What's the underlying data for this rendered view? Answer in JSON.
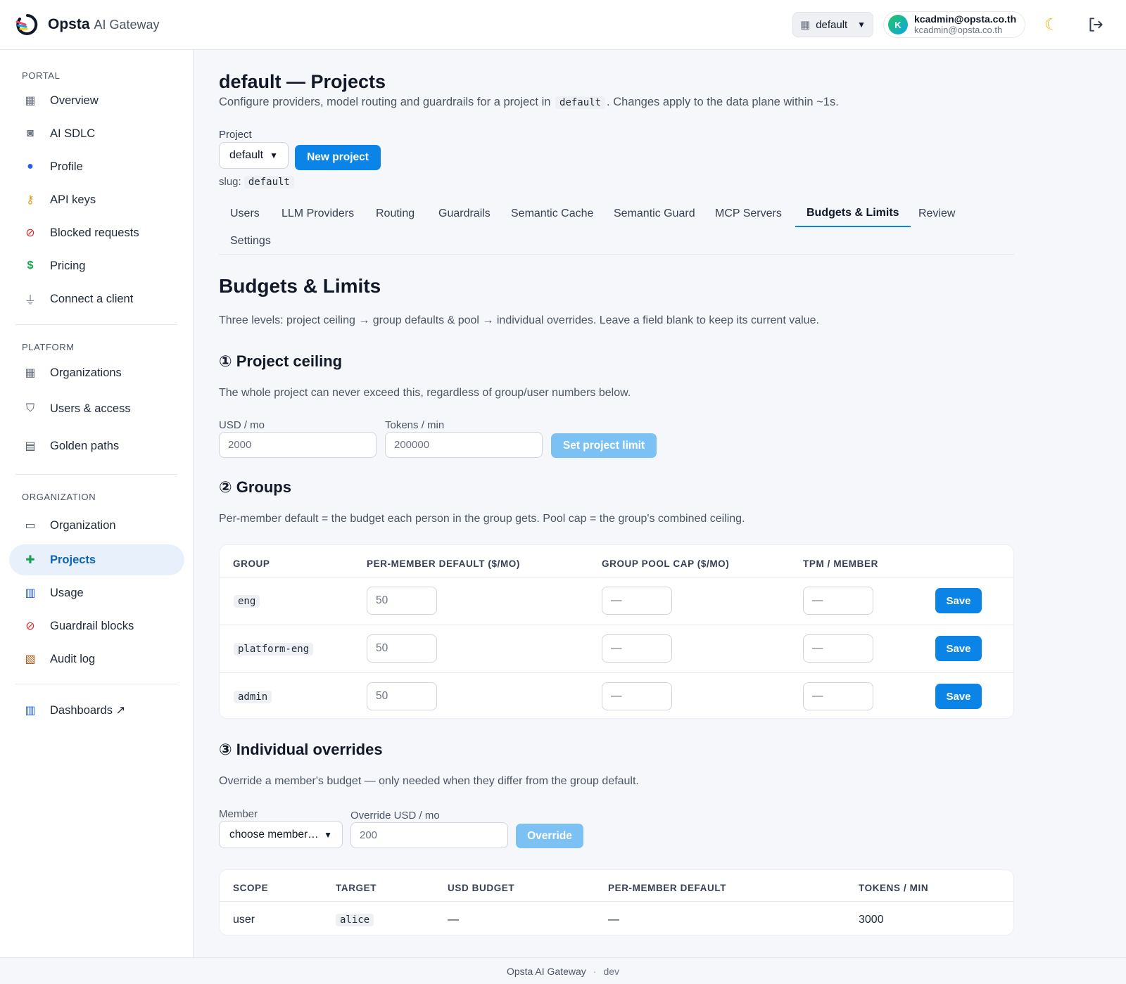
{
  "header": {
    "brand_name": "Opsta",
    "brand_sub": "AI Gateway",
    "org_select": "default",
    "user_name": "kcadmin@opsta.co.th",
    "user_email": "kcadmin@opsta.co.th",
    "avatar_initial": "K"
  },
  "sidebar": {
    "portal_title": "PORTAL",
    "portal": [
      {
        "label": "Overview",
        "icon": "grid-icon"
      },
      {
        "label": "AI SDLC",
        "icon": "robot-icon"
      },
      {
        "label": "Profile",
        "icon": "user-icon"
      },
      {
        "label": "API keys",
        "icon": "key-icon"
      },
      {
        "label": "Blocked requests",
        "icon": "blocked-icon"
      },
      {
        "label": "Pricing",
        "icon": "dollar-icon"
      },
      {
        "label": "Connect a client",
        "icon": "plug-icon"
      }
    ],
    "platform_title": "PLATFORM",
    "platform": [
      {
        "label": "Organizations",
        "icon": "building-icon"
      },
      {
        "label": "Users & access",
        "icon": "shield-icon"
      },
      {
        "label": "Golden paths",
        "icon": "id-card-icon"
      }
    ],
    "organization_title": "ORGANIZATION",
    "organization": [
      {
        "label": "Organization",
        "icon": "window-icon"
      },
      {
        "label": "Projects",
        "icon": "puzzle-icon"
      },
      {
        "label": "Usage",
        "icon": "bar-chart-icon"
      },
      {
        "label": "Guardrail blocks",
        "icon": "blocked-icon"
      },
      {
        "label": "Audit log",
        "icon": "scroll-icon"
      }
    ],
    "dashboards": {
      "label": "Dashboards ↗",
      "icon": "bar-chart-icon"
    }
  },
  "page": {
    "title": "default — Projects",
    "desc_pre": "Configure providers, model routing and guardrails for a project in",
    "desc_code": "default",
    "desc_post": ". Changes apply to the data plane within ~1s.",
    "project_label": "Project",
    "project_value": "default",
    "new_project": "New project",
    "slug_label": "slug:",
    "slug_value": "default"
  },
  "tabs": [
    "Users",
    "LLM Providers",
    "Routing",
    "Guardrails",
    "Semantic Cache",
    "Semantic Guard",
    "MCP Servers",
    "Budgets & Limits",
    "Review",
    "Settings"
  ],
  "active_tab": "Budgets & Limits",
  "budgets": {
    "title": "Budgets & Limits",
    "intro": "Three levels: project ceiling → group defaults & pool → individual overrides. Leave a field blank to keep its current value.",
    "ceiling": {
      "title": "① Project ceiling",
      "desc": "The whole project can never exceed this, regardless of group/user numbers below.",
      "usd_label": "USD / mo",
      "usd_placeholder": "2000",
      "tpm_label": "Tokens / min",
      "tpm_placeholder": "200000",
      "button": "Set project limit"
    },
    "groups": {
      "title": "② Groups",
      "desc": "Per-member default = the budget each person in the group gets. Pool cap = the group's combined ceiling.",
      "headers": [
        "GROUP",
        "PER-MEMBER DEFAULT ($/MO)",
        "GROUP POOL CAP ($/MO)",
        "TPM / MEMBER"
      ],
      "rows": [
        {
          "group": "eng",
          "per_member": "50",
          "pool_cap": "—",
          "tpm": "—"
        },
        {
          "group": "platform-eng",
          "per_member": "50",
          "pool_cap": "—",
          "tpm": "—"
        },
        {
          "group": "admin",
          "per_member": "50",
          "pool_cap": "—",
          "tpm": "—"
        }
      ],
      "save_label": "Save"
    },
    "overrides": {
      "title": "③ Individual overrides",
      "desc": "Override a member's budget — only needed when they differ from the group default.",
      "member_label": "Member",
      "member_value": "choose member…",
      "usd_label": "Override USD / mo",
      "usd_placeholder": "200",
      "button": "Override",
      "headers": [
        "SCOPE",
        "TARGET",
        "USD BUDGET",
        "PER-MEMBER DEFAULT",
        "TOKENS / MIN"
      ],
      "rows": [
        {
          "scope": "user",
          "target": "alice",
          "usd": "—",
          "per_member": "—",
          "tokens": "3000"
        }
      ]
    }
  },
  "footer": {
    "app": "Opsta AI Gateway",
    "sep": "·",
    "env": "dev"
  }
}
